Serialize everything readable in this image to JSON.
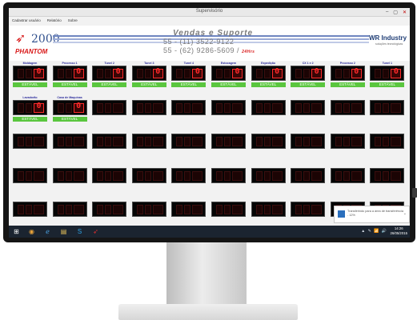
{
  "window": {
    "title": "Supervisório",
    "controls": [
      "–",
      "▢",
      "✕"
    ]
  },
  "menu": [
    "Cadastrar usuário",
    "Relatório",
    "Sobre"
  ],
  "banner": {
    "logo_number": "2000",
    "logo_name": "PHANTOM",
    "headline": "Vendas e Suporte",
    "phone1": "55 - (11) 3522-9122",
    "phone2": "55 - (62) 9286-5609 / ",
    "hours": "24Hrs",
    "company": "WR Industry",
    "company_sub": "soluções tecnológicas"
  },
  "panels": [
    {
      "label": "Moldagem",
      "value": "0",
      "status": "ESTÁVEL"
    },
    {
      "label": "Processo 1",
      "value": "0",
      "status": "ESTÁVEL"
    },
    {
      "label": "Tunel 2",
      "value": "0",
      "status": "ESTÁVEL"
    },
    {
      "label": "Tunel 3",
      "value": "0",
      "status": "ESTÁVEL"
    },
    {
      "label": "Tunel 4",
      "value": "0",
      "status": "ESTÁVEL"
    },
    {
      "label": "Estocagem",
      "value": "0",
      "status": "ESTÁVEL"
    },
    {
      "label": "Expedição",
      "value": "0",
      "status": "ESTÁVEL"
    },
    {
      "label": "CX 1 e 2",
      "value": "0",
      "status": "ESTÁVEL"
    },
    {
      "label": "Processo 2",
      "value": "0",
      "status": "ESTÁVEL"
    },
    {
      "label": "Tunel 1",
      "value": "0",
      "status": "ESTÁVEL"
    },
    {
      "label": "Lavadorão",
      "value": "0",
      "status": "ESTÁVEL"
    },
    {
      "label": "Casa de Maquinas",
      "value": "0",
      "status": "ESTÁVEL"
    }
  ],
  "empty_displays": {
    "rows_after_active": 4,
    "columns": 10
  },
  "notification": {
    "text": "Transferindo para a área de transferência - 12%",
    "progress_percent": 12
  },
  "taskbar": {
    "apps": [
      "windows-start-icon",
      "chrome-icon",
      "internet-explorer-icon",
      "file-explorer-icon",
      "skype-icon",
      "phantom-app-icon"
    ],
    "tray": "▲ ✎ 📶 🔊",
    "time": "14:26",
    "date": "26/05/2015"
  },
  "colors": {
    "status_green": "#5ac63e",
    "display_red": "#ff2a2a",
    "label_blue": "#2c2c9c",
    "logo_red": "#d81818",
    "logo_blue": "#304f8c"
  }
}
